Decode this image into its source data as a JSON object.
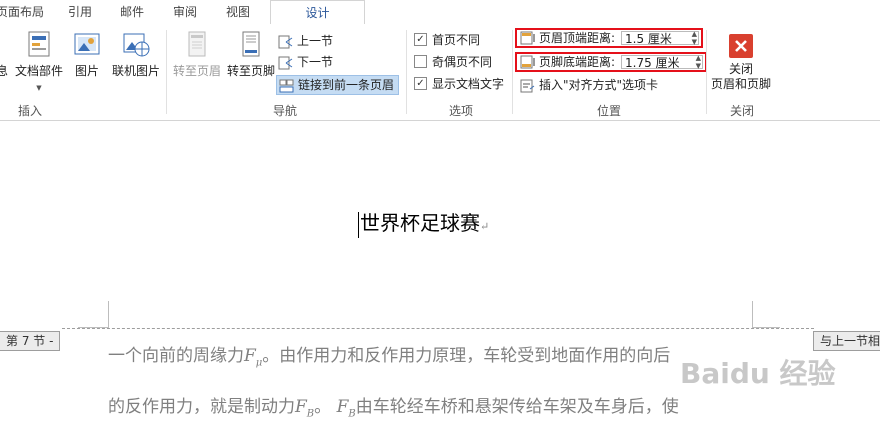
{
  "tabs": [
    "页面布局",
    "引用",
    "邮件",
    "审阅",
    "视图",
    "设计"
  ],
  "active_tab": "设计",
  "groups": {
    "insert": {
      "label": "插入",
      "buttons": [
        "息",
        "文档部件",
        "图片",
        "联机图片"
      ]
    },
    "nav": {
      "label": "导航",
      "goto_header": "转至页眉",
      "goto_footer": "转至页脚",
      "prev_section": "上一节",
      "next_section": "下一节",
      "link_prev": "链接到前一条页眉"
    },
    "options": {
      "label": "选项",
      "first_page": "首页不同",
      "odd_even": "奇偶页不同",
      "show_doc_text": "显示文档文字"
    },
    "position": {
      "label": "位置",
      "header_top_label": "页眉顶端距离:",
      "header_top_value": "1.5 厘米",
      "footer_bottom_label": "页脚底端距离:",
      "footer_bottom_value": "1.75 厘米",
      "insert_align_tab": "插入\"对齐方式\"选项卡"
    },
    "close": {
      "label": "关闭",
      "close_button": "关闭\n页眉和页脚"
    }
  },
  "document": {
    "footer_title": "世界杯足球赛",
    "section_tag": "第 7 节 -",
    "same_as_prev": "与上一节相",
    "para1": "一个向前的周缘力",
    "para1_var": "F",
    "para1_sub": "μ",
    "para1_rest": "。由作用力和反作用力原理，车轮受到地面作用的向后",
    "para2": "的反作用力，就是制动力",
    "para2_var": "F",
    "para2_sub": "B",
    "para2_mid": "。",
    "para2_var2": "F",
    "para2_sub2": "B",
    "para2_rest": "由车轮经车桥和悬架传给车架及车身后，使"
  },
  "watermark": "Baidu 经验",
  "colors": {
    "accent": "#2b579a",
    "highlight_box": "#e5101a",
    "close_red": "#d9402f"
  }
}
